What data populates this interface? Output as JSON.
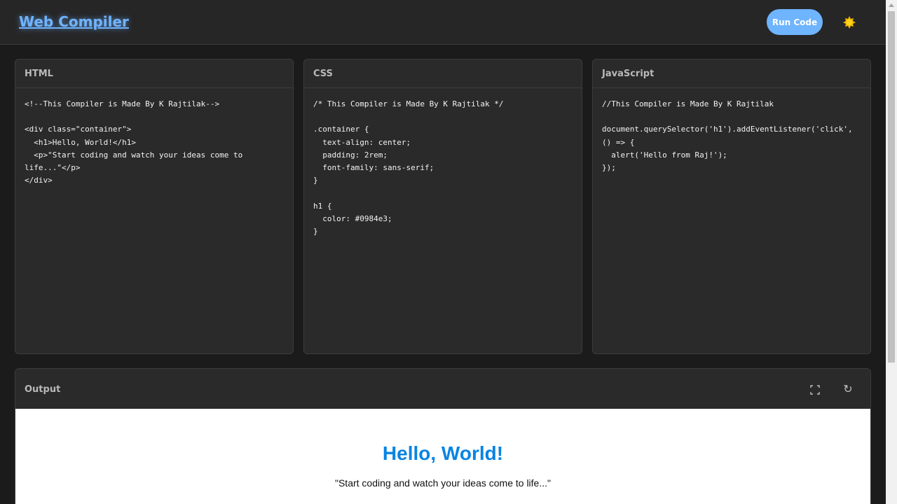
{
  "header": {
    "brand": "Web Compiler",
    "run_label": "Run Code",
    "theme_icon": "sun-icon"
  },
  "editors": [
    {
      "title": "HTML",
      "code": "<!--This Compiler is Made By K Rajtilak-->\n\n<div class=\"container\">\n  <h1>Hello, World!</h1>\n  <p>\"Start coding and watch your ideas come to\nlife...\"</p>\n</div>"
    },
    {
      "title": "CSS",
      "code": "/* This Compiler is Made By K Rajtilak */\n\n.container {\n  text-align: center;\n  padding: 2rem;\n  font-family: sans-serif;\n}\n\nh1 {\n  color: #0984e3;\n}"
    },
    {
      "title": "JavaScript",
      "code": "//This Compiler is Made By K Rajtilak\n\ndocument.querySelector('h1').addEventListener('click',\n() => {\n  alert('Hello from Raj!');\n});"
    }
  ],
  "output": {
    "title": "Output",
    "icons": [
      "fullscreen-icon",
      "refresh-icon"
    ],
    "preview": {
      "heading": "Hello, World!",
      "paragraph": "\"Start coding and watch your ideas come to life...\""
    }
  },
  "colors": {
    "accent": "#6fb4ff",
    "heading_blue": "#0984e3",
    "background": "#1b1b1b",
    "panel": "#2a2a2a"
  }
}
